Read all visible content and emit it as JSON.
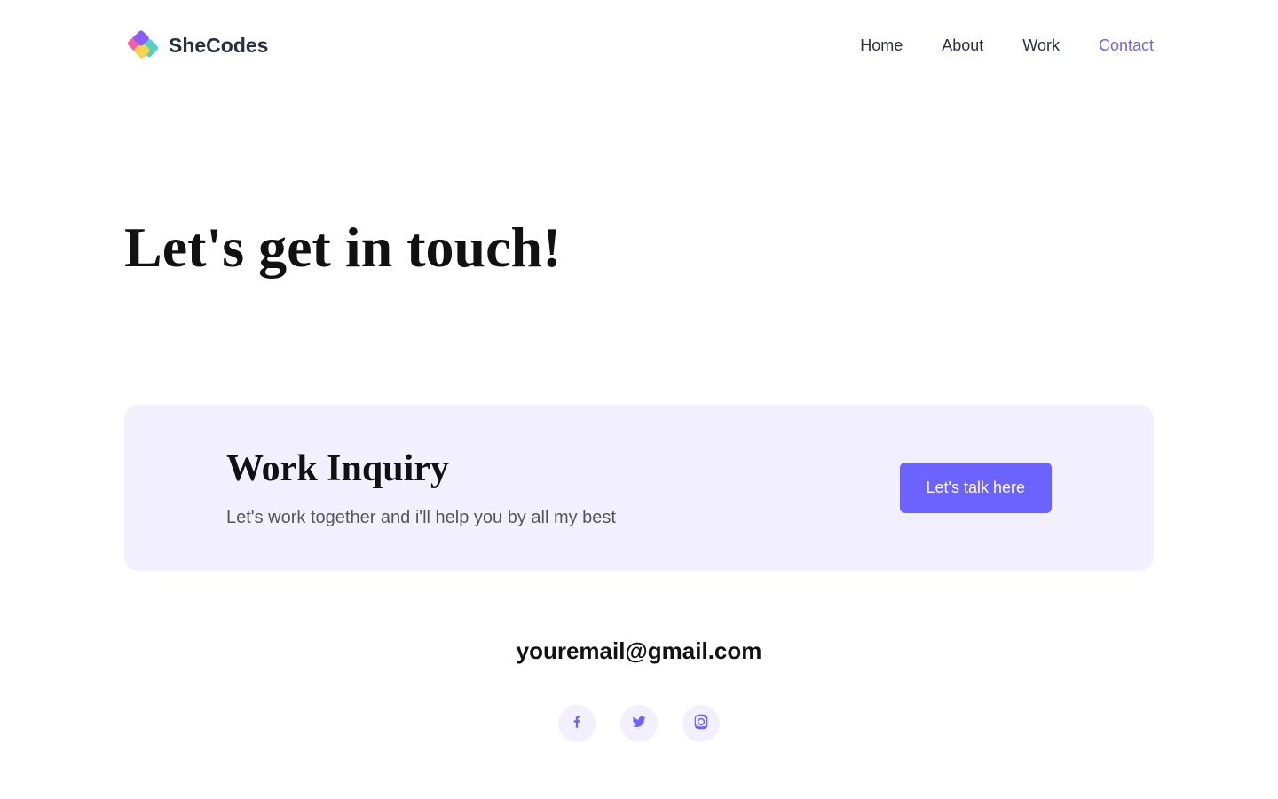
{
  "brand": {
    "name": "SheCodes"
  },
  "nav": {
    "items": [
      {
        "label": "Home",
        "active": false
      },
      {
        "label": "About",
        "active": false
      },
      {
        "label": "Work",
        "active": false
      },
      {
        "label": "Contact",
        "active": true
      }
    ]
  },
  "hero": {
    "title": "Let's get in touch!"
  },
  "card": {
    "title": "Work Inquiry",
    "subtitle": "Let's work  together and i'll help you by all my best",
    "cta": "Let's talk here"
  },
  "contact": {
    "email": "youremail@gmail.com"
  },
  "socials": {
    "items": [
      {
        "name": "facebook"
      },
      {
        "name": "twitter"
      },
      {
        "name": "instagram"
      }
    ]
  },
  "colors": {
    "accent": "#6c63ff",
    "card_bg": "#f2f0fe",
    "text_dark": "#2a2e42"
  }
}
